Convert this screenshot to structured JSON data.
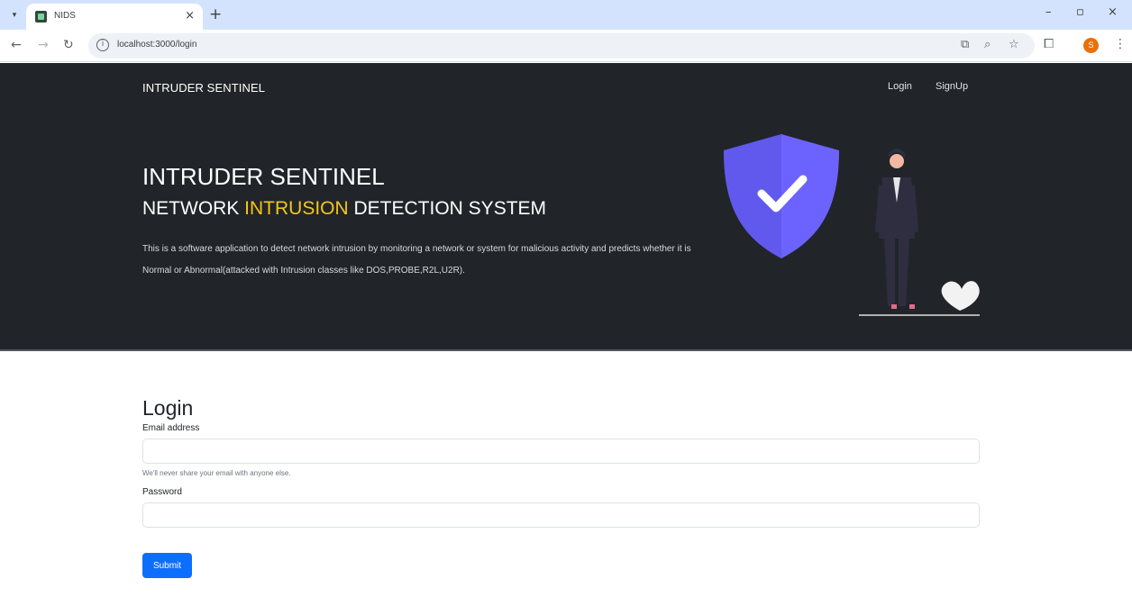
{
  "browser": {
    "tab_title": "NIDS",
    "url": "localhost:3000/login",
    "profile_initial": "S"
  },
  "navbar": {
    "brand": "INTRUDER SENTINEL",
    "links": [
      "Login",
      "SignUp"
    ]
  },
  "hero": {
    "title": "INTRUDER SENTINEL",
    "subtitle_before": "NETWORK ",
    "subtitle_highlight": "INTRUSION",
    "subtitle_after": " DETECTION SYSTEM",
    "description": "This is a software application to detect network intrusion by monitoring a network or system for malicious activity and predicts whether it is Normal or Abnormal(attacked with Intrusion classes like DOS,PROBE,R2L,U2R).",
    "highlight_color": "#f5c518"
  },
  "login": {
    "title": "Login",
    "email_label": "Email address",
    "email_value": "",
    "email_help": "We'll never share your email with anyone else.",
    "password_label": "Password",
    "password_value": "",
    "submit_label": "Submit"
  },
  "colors": {
    "hero_bg": "#212529",
    "primary": "#0d6efd",
    "shield": "#6c63ff"
  }
}
